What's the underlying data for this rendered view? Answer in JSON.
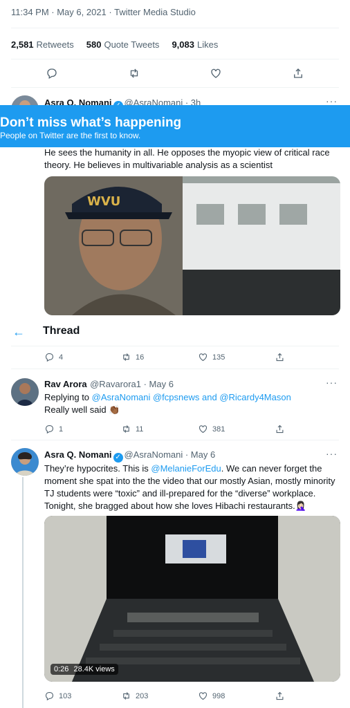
{
  "header": {
    "meta": "11:34 PM · May 6, 2021 · Twitter Media Studio",
    "stats": [
      {
        "value": "2,581",
        "label": "Retweets"
      },
      {
        "value": "580",
        "label": "Quote Tweets"
      },
      {
        "value": "9,083",
        "label": "Likes"
      }
    ]
  },
  "quoted": {
    "name": "Asra Q. Nomani",
    "handle": "@AsraNomani · 3h",
    "text": "He sees the humanity in all.  He opposes the myopic view of critical race theory. He believes in multivariable analysis as a scientist",
    "image_caption": "WVU"
  },
  "banner": {
    "title": "Don’t miss what’s happening",
    "subtitle": "People on Twitter are the first to know."
  },
  "thread": {
    "title": "Thread",
    "first_actions": {
      "replies": "4",
      "retweets": "16",
      "likes": "135"
    }
  },
  "reply1": {
    "name": "Rav Arora",
    "handle": "@Ravarora1 · May 6",
    "replying_prefix": "Replying to ",
    "replying_to": "@AsraNomani @fcpsnews",
    "replying_and": " and ",
    "replying_last": "@Ricardy4Mason",
    "text": "Really well said",
    "emoji": "👏🏾",
    "actions": {
      "replies": "1",
      "retweets": "11",
      "likes": "381"
    }
  },
  "reply2": {
    "name": "Asra Q. Nomani",
    "handle": "@AsraNomani · May 6",
    "text_a": "They’re hypocrites. This is ",
    "mention": "@MelanieForEdu",
    "text_b": ". We can never forget the moment she spat into the the video that our mostly Asian, mostly minority TJ students were “toxic” and ill-prepared for the “diverse” workplace. Tonight, she bragged about how she loves Hibachi restaurants.",
    "emoji": "🤦🏻‍♀️",
    "video_time": "0:26",
    "video_views": "28.4K views",
    "actions": {
      "replies": "103",
      "retweets": "203",
      "likes": "998"
    }
  },
  "colors": {
    "accent": "#1d9bf0",
    "muted": "#536471"
  }
}
